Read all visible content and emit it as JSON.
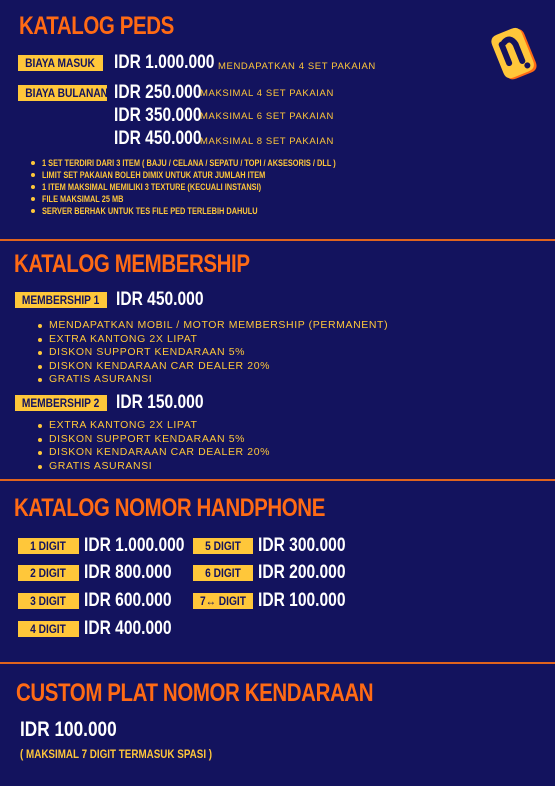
{
  "peds": {
    "title": "KATALOG PEDS",
    "masuk": {
      "label": "BIAYA MASUK",
      "price": "IDR 1.000.000",
      "note": "MENDAPATKAN 4 SET PAKAIAN"
    },
    "bulanan": {
      "label": "BIAYA BULANAN",
      "tiers": [
        {
          "price": "IDR 250.000",
          "note": "MAKSIMAL 4 SET PAKAIAN"
        },
        {
          "price": "IDR 350.000",
          "note": "MAKSIMAL 6 SET PAKAIAN"
        },
        {
          "price": "IDR 450.000",
          "note": "MAKSIMAL 8 SET PAKAIAN"
        }
      ]
    },
    "rules": [
      "1 SET TERDIRI DARI 3 ITEM ( BAJU / CELANA / SEPATU / TOPI / AKSESORIS / DLL )",
      "LIMIT SET PAKAIAN BOLEH DIMIX UNTUK ATUR JUMLAH ITEM",
      "1 ITEM MAKSIMAL MEMILIKI 3 TEXTURE (KECUALI INSTANSI)",
      "FILE MAKSIMAL 25 MB",
      "SERVER BERHAK UNTUK TES FILE PED TERLEBIH DAHULU"
    ]
  },
  "membership": {
    "title": "KATALOG MEMBERSHIP",
    "m1": {
      "label": "MEMBERSHIP 1",
      "price": "IDR 450.000",
      "benefits": [
        "MENDAPATKAN MOBIL / MOTOR MEMBERSHIP (PERMANENT)",
        "EXTRA KANTONG 2X LIPAT",
        "DISKON SUPPORT KENDARAAN 5%",
        "DISKON KENDARAAN CAR DEALER 20%",
        "GRATIS ASURANSI"
      ]
    },
    "m2": {
      "label": "MEMBERSHIP 2",
      "price": "IDR 150.000",
      "benefits": [
        "EXTRA KANTONG 2X LIPAT",
        "DISKON SUPPORT KENDARAAN 5%",
        "DISKON KENDARAAN CAR DEALER 20%",
        "GRATIS ASURANSI"
      ]
    }
  },
  "phone": {
    "title": "KATALOG NOMOR HANDPHONE",
    "left": [
      {
        "label": "1 DIGIT",
        "price": "IDR 1.000.000"
      },
      {
        "label": "2 DIGIT",
        "price": "IDR 800.000"
      },
      {
        "label": "3 DIGIT",
        "price": "IDR 600.000"
      },
      {
        "label": "4 DIGIT",
        "price": "IDR 400.000"
      }
    ],
    "right": [
      {
        "label": "5 DIGIT",
        "price": "IDR 300.000"
      },
      {
        "label": "6 DIGIT",
        "price": "IDR 200.000"
      },
      {
        "label": "7↔ DIGIT",
        "price": "IDR 100.000"
      }
    ]
  },
  "plate": {
    "title": "CUSTOM PLAT NOMOR KENDARAAN",
    "price": "IDR 100.000",
    "note": "( MAKSIMAL 7 DIGIT TERMASUK SPASI )"
  },
  "colors": {
    "background": "#13135e",
    "accent_orange": "#ff6a14",
    "accent_yellow": "#ffc73a"
  },
  "logo": {
    "icon": "yellow-orange-brand-logo-icon"
  }
}
